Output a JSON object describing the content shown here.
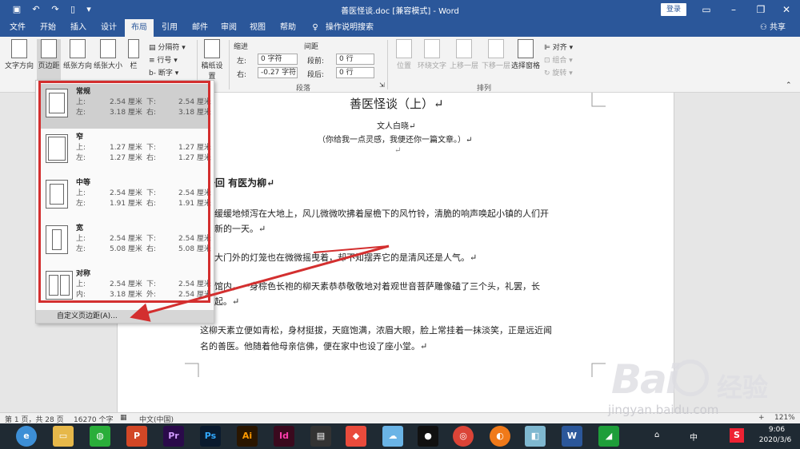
{
  "window": {
    "title": "善医怪谈.doc [兼容模式] - Word",
    "login": "登录"
  },
  "tabs": [
    "文件",
    "开始",
    "插入",
    "设计",
    "布局",
    "引用",
    "邮件",
    "审阅",
    "视图",
    "帮助",
    "操作说明搜索"
  ],
  "share": "共享",
  "ribbon": {
    "text_direction": "文字方向",
    "margins": "页边距",
    "orientation": "纸张方向",
    "size": "纸张大小",
    "columns": "栏",
    "breaks": "分隔符",
    "line_numbers": "行号",
    "hyphenation": "断字",
    "draft": "稿纸设置",
    "indent_label": "缩进",
    "spacing_label": "间距",
    "indent_left_label": "左:",
    "indent_left_value": "0 字符",
    "indent_right_label": "右:",
    "indent_right_value": "-0.27 字符",
    "before_label": "段前:",
    "before_value": "0 行",
    "after_label": "段后:",
    "after_value": "0 行",
    "group_paragraph": "段落",
    "position": "位置",
    "wrap_text": "环绕文字",
    "bring_forward": "上移一层",
    "send_backward": "下移一层",
    "selection_pane": "选择窗格",
    "align": "对齐",
    "group": "组合",
    "rotate": "旋转",
    "group_arrange": "排列"
  },
  "margins_menu": {
    "options": [
      {
        "name": "常规",
        "top_label": "上:",
        "top": "2.54 厘米",
        "bottom_label": "下:",
        "bottom": "2.54 厘米",
        "left_label": "左:",
        "left": "3.18 厘米",
        "right_label": "右:",
        "right": "3.18 厘米"
      },
      {
        "name": "窄",
        "top_label": "上:",
        "top": "1.27 厘米",
        "bottom_label": "下:",
        "bottom": "1.27 厘米",
        "left_label": "左:",
        "left": "1.27 厘米",
        "right_label": "右:",
        "right": "1.27 厘米"
      },
      {
        "name": "中等",
        "top_label": "上:",
        "top": "2.54 厘米",
        "bottom_label": "下:",
        "bottom": "2.54 厘米",
        "left_label": "左:",
        "left": "1.91 厘米",
        "right_label": "右:",
        "right": "1.91 厘米"
      },
      {
        "name": "宽",
        "top_label": "上:",
        "top": "2.54 厘米",
        "bottom_label": "下:",
        "bottom": "2.54 厘米",
        "left_label": "左:",
        "left": "5.08 厘米",
        "right_label": "右:",
        "right": "5.08 厘米"
      },
      {
        "name": "对称",
        "top_label": "上:",
        "top": "2.54 厘米",
        "bottom_label": "下:",
        "bottom": "2.54 厘米",
        "left_label": "内:",
        "left": "3.18 厘米",
        "right_label": "外:",
        "right": "2.54 厘米"
      }
    ],
    "custom": "自定义页边距(A)..."
  },
  "document": {
    "title": "善医怪谈（上）↵",
    "author": "文人白晓↵",
    "motto": "（你给我一点灵感，我便还你一篇文章。）↵",
    "blank": "↵",
    "chapter": "一回  有医为柳↵",
    "p1a": "光缓缓地倾泻在大地上，风儿微微吹拂着屋檐下的风竹铃，清脆的响声唤起小镇的人们开",
    "p1b": "了新的一天。↵",
    "p2": "堂大门外的灯笼也在微微摇曳着，却不知摆弄它的是清风还是人气。↵",
    "p3a": "医馆内，一身棕色长袍的柳天素恭恭敬敬地对着观世音菩萨雕像磕了三个头，礼罢，长",
    "p3b": "而起。↵",
    "p4a": "这柳天素立便如青松，身材挺拔，天庭饱满，浓眉大眼，脸上常挂着一抹淡笑，正是远近闻",
    "p4b": "名的善医。他随着他母亲信佛，便在家中也设了座小堂。↵"
  },
  "status": {
    "page": "第 1 页，共 28 页",
    "words": "16270 个字",
    "lang": "中文(中国)",
    "zoom": "121%"
  },
  "taskbar": {
    "time": "9:06",
    "date": "2020/3/6",
    "ime": "中"
  },
  "watermark": {
    "brand": "Bai",
    "brand2": "经验",
    "url": "jingyan.baidu.com"
  },
  "colors": {
    "word_blue": "#2b579a",
    "highlight_red": "#d32f2f"
  }
}
